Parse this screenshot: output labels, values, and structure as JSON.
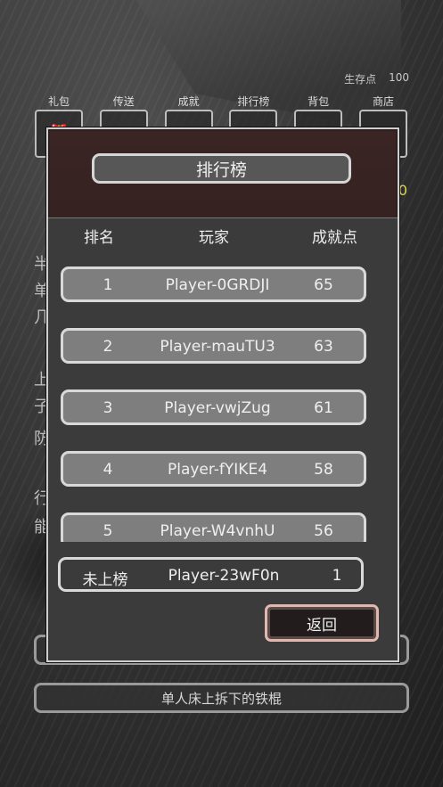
{
  "background": {
    "survival_label": "生存点",
    "survival_value": "100",
    "toolbar": [
      {
        "label": "礼包",
        "icon": "gift-icon",
        "glyph": "🎁"
      },
      {
        "label": "传送",
        "icon": "teleport-icon",
        "glyph": "⚲"
      },
      {
        "label": "成就",
        "icon": "achievement-icon",
        "glyph": "▲"
      },
      {
        "label": "排行榜",
        "icon": "leaderboard-icon",
        "glyph": "★"
      },
      {
        "label": "背包",
        "icon": "backpack-icon",
        "glyph": "◎"
      },
      {
        "label": "商店",
        "icon": "shop-icon",
        "glyph": "▭"
      }
    ],
    "side_chars": [
      "半",
      "单",
      "几",
      "上",
      "子",
      "防",
      "行",
      "能"
    ],
    "yellow_fragment": "0",
    "bottom_button_label": "单人床上拆下的铁棍"
  },
  "leaderboard": {
    "title": "排行榜",
    "headers": {
      "rank": "排名",
      "player": "玩家",
      "points": "成就点"
    },
    "rows": [
      {
        "rank": "1",
        "player": "Player-0GRDJI",
        "points": "65"
      },
      {
        "rank": "2",
        "player": "Player-mauTU3",
        "points": "63"
      },
      {
        "rank": "3",
        "player": "Player-vwjZug",
        "points": "61"
      },
      {
        "rank": "4",
        "player": "Player-fYIKE4",
        "points": "58"
      },
      {
        "rank": "5",
        "player": "Player-W4vnhU",
        "points": "56"
      }
    ],
    "me": {
      "rank": "未上榜",
      "player": "Player-23wF0n",
      "points": "1"
    },
    "back_label": "返回"
  }
}
